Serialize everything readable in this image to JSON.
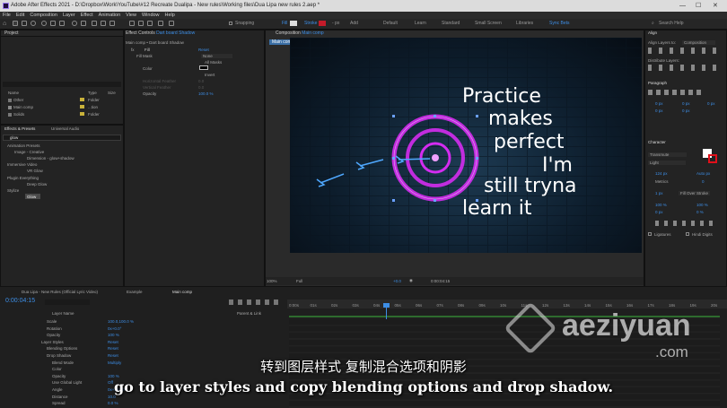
{
  "titlebar": {
    "title": "Adobe After Effects 2021 - D:\\Dropbox\\Work\\YouTube\\#12 Recreate Dualipa - New rules\\Working files\\Dua Lipa new rules 2.aep *",
    "minimize": "—",
    "maximize": "☐",
    "close": "✕"
  },
  "menubar": [
    "File",
    "Edit",
    "Composition",
    "Layer",
    "Effect",
    "Animation",
    "View",
    "Window",
    "Help"
  ],
  "toolbar": {
    "snapping": "Snapping",
    "fill": "Fill",
    "stroke": "Stroke",
    "stroke_px": "- px",
    "add": "Add",
    "workspaces": [
      "Default",
      "Learn",
      "Standard",
      "Small Screen",
      "Libraries"
    ],
    "active_workspace": "Sync Bets",
    "search_placeholder": "Search Help"
  },
  "project": {
    "title": "Project",
    "columns": [
      "Name",
      "Type",
      "Size"
    ],
    "items": [
      {
        "name": "Other",
        "type": "Folder",
        "color": "#c9b23a"
      },
      {
        "name": "Main comp",
        "type": "...tion",
        "color": "#c9b23a"
      },
      {
        "name": "Solids",
        "type": "Folder",
        "color": "#c9b23a"
      }
    ]
  },
  "effects_presets": {
    "tabs": [
      "Effects & Presets",
      "Universal Audio"
    ],
    "search_value": "glow",
    "tree": [
      "Animation Presets",
      "Image - Creative",
      "Dimension - glow+shadow",
      "Immersive Video",
      "VR Glow",
      "Plugin Everything",
      "Deep Glow",
      "Stylize",
      "Glow"
    ]
  },
  "effect_controls": {
    "tab": "Effect Controls",
    "layer": "Dart board Shadow",
    "breadcrumb": "Main comp • Dart board Shadow",
    "fx_name": "Fill",
    "reset": "Reset",
    "rows": [
      {
        "label": "Fill Mask",
        "value": "None"
      },
      {
        "label": "",
        "value": "All Masks"
      },
      {
        "label": "Color",
        "value": ""
      },
      {
        "label": "",
        "value": "Invert"
      },
      {
        "label": "Horizontal Feather",
        "value": "0.0"
      },
      {
        "label": "Vertical Feather",
        "value": "0.0"
      },
      {
        "label": "Opacity",
        "value": "100.0 %"
      }
    ]
  },
  "composition": {
    "tab": "Composition",
    "name": "Main comp",
    "subtab": "Main comp",
    "zoom": "100%",
    "quality": "Full",
    "timecode": "0:00:04:15",
    "exposure": "+0.0",
    "lyrics": [
      "Practice",
      "makes",
      "perfect",
      "I'm",
      "still tryna",
      "learn it"
    ],
    "ring_color": "#d42cf0"
  },
  "align": {
    "title": "Align",
    "align_layers_to": "Align Layers to:",
    "target": "Composition",
    "distribute": "Distribute Layers:"
  },
  "paragraph": {
    "title": "Paragraph",
    "values": [
      "0 px",
      "0 px",
      "0 px",
      "0 px",
      "0 px"
    ]
  },
  "character": {
    "title": "Character",
    "font": "Transmute",
    "style": "Light",
    "size": "124 px",
    "leading": "Auto px",
    "kerning": "Metrics",
    "tracking": "0",
    "stroke_width": "1 px",
    "stroke_type": "Fill Over Stroke",
    "vscale": "100 %",
    "hscale": "100 %",
    "baseline": "0 px",
    "tsume": "0 %",
    "ligatures": "Ligatures",
    "hindi": "Hindi Digits",
    "fill_color": "#ffffff",
    "stroke_color": "#e0101a"
  },
  "timeline": {
    "tabs": [
      "Dua Lipa - New Rules (Official Lyric Video)",
      "Example",
      "Main comp"
    ],
    "timecode": "0:00:04:15",
    "columns": [
      "Layer Name",
      "Parent & Link"
    ],
    "ruler": [
      "0:00s",
      "01s",
      "02s",
      "03s",
      "04s",
      "05s",
      "06s",
      "07s",
      "08s",
      "09s",
      "10s",
      "11s",
      "12s",
      "13s",
      "14s",
      "15s",
      "16s",
      "17s",
      "18s",
      "19s",
      "20s"
    ],
    "rows": [
      {
        "label": "Scale",
        "value": "100.0,100.0 %",
        "indent": 2
      },
      {
        "label": "Rotation",
        "value": "0x+0.0°",
        "indent": 2
      },
      {
        "label": "Opacity",
        "value": "100 %",
        "indent": 2
      },
      {
        "label": "Layer Styles",
        "value": "Reset",
        "indent": 1
      },
      {
        "label": "Blending Options",
        "value": "Reset",
        "indent": 2
      },
      {
        "label": "Drop Shadow",
        "value": "Reset",
        "indent": 2
      },
      {
        "label": "Blend Mode",
        "value": "Multiply",
        "indent": 3
      },
      {
        "label": "Color",
        "value": "",
        "indent": 3
      },
      {
        "label": "Opacity",
        "value": "100 %",
        "indent": 3
      },
      {
        "label": "Use Global Light",
        "value": "Off",
        "indent": 3
      },
      {
        "label": "Angle",
        "value": "0x+120.0°",
        "indent": 3
      },
      {
        "label": "Distance",
        "value": "10.0",
        "indent": 3
      },
      {
        "label": "Spread",
        "value": "0.0 %",
        "indent": 3
      }
    ]
  },
  "subtitles": {
    "zh": "转到图层样式 复制混合选项和阴影",
    "en": "go to layer styles and copy blending options and drop shadow."
  },
  "watermark": {
    "name": "aeziyuan",
    "domain": ".com"
  }
}
